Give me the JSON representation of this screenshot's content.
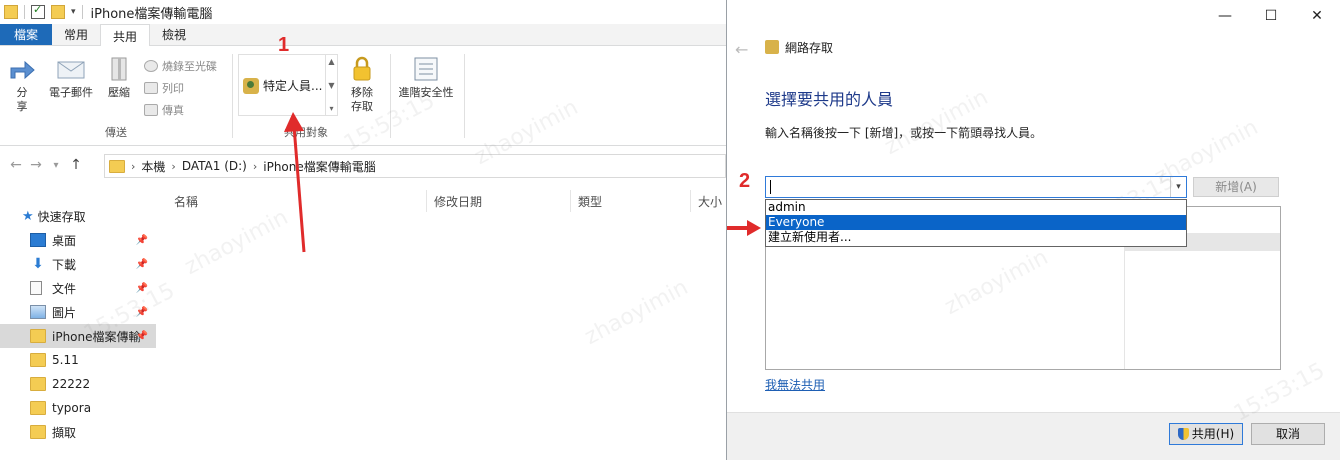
{
  "explorer": {
    "title": "iPhone檔案傳輸電腦",
    "tabs": [
      {
        "label": "檔案"
      },
      {
        "label": "常用"
      },
      {
        "label": "共用"
      },
      {
        "label": "檢視"
      }
    ],
    "ribbon": {
      "send_group": {
        "label": "傳送",
        "share": "分\n享",
        "email": "電子郵件",
        "zip": "壓縮",
        "burn": "燒錄至光碟",
        "print": "列印",
        "fax": "傳真"
      },
      "share_with_group": {
        "label": "共用對象",
        "specific_people": "特定人員...",
        "remove_access": "移除\n存取"
      },
      "advanced_security": "進階安全性"
    },
    "address": {
      "crumbs": [
        "本機",
        "DATA1 (D:)",
        "iPhone檔案傳輸電腦"
      ]
    },
    "nav": {
      "quick_access": "快速存取",
      "items": [
        {
          "label": "桌面",
          "icon": "desktop-icon"
        },
        {
          "label": "下載",
          "icon": "download-icon"
        },
        {
          "label": "文件",
          "icon": "document-icon"
        },
        {
          "label": "圖片",
          "icon": "picture-icon"
        },
        {
          "label": "iPhone檔案傳輸",
          "icon": "folder-icon"
        },
        {
          "label": "5.11",
          "icon": "folder-icon"
        },
        {
          "label": "22222",
          "icon": "folder-icon"
        },
        {
          "label": "typora",
          "icon": "folder-icon"
        },
        {
          "label": "擷取",
          "icon": "folder-icon"
        }
      ]
    },
    "columns": [
      "名稱",
      "修改日期",
      "類型",
      "大小"
    ]
  },
  "dialog": {
    "title": "網路存取",
    "heading": "選擇要共用的人員",
    "instruction": "輸入名稱後按一下 [新增]，或按一下箭頭尋找人員。",
    "add_button": "新增(A)",
    "dropdown_options": [
      {
        "label": "admin"
      },
      {
        "label": "Everyone"
      },
      {
        "label": "建立新使用者..."
      }
    ],
    "help_link": "我無法共用",
    "share_button": "共用(H)",
    "cancel_button": "取消"
  },
  "annotations": {
    "step1": "1",
    "step2": "2",
    "color": "#e02b2b"
  },
  "watermark": {
    "text": "zhaoyimin",
    "time": "15:53:15"
  },
  "colors": {
    "file_tab": "#1e6ab8",
    "heading": "#1e3a8a",
    "selection": "#0a64c8",
    "link": "#1e5fb4"
  }
}
